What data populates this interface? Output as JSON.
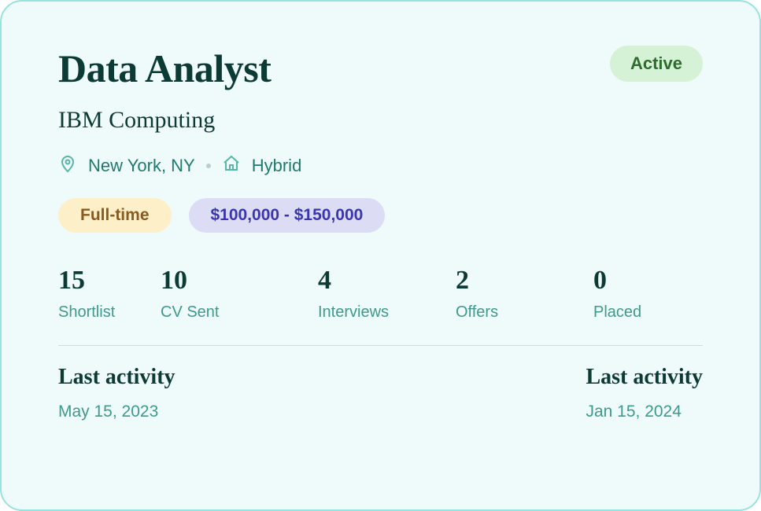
{
  "job": {
    "title": "Data Analyst",
    "company": "IBM Computing",
    "location": "New York, NY",
    "work_mode": "Hybrid",
    "status": "Active",
    "employment_type": "Full-time",
    "salary_range": "$100,000 - $150,000"
  },
  "stats": [
    {
      "value": "15",
      "label": "Shortlist"
    },
    {
      "value": "10",
      "label": "CV Sent"
    },
    {
      "value": "4",
      "label": "Interviews"
    },
    {
      "value": "2",
      "label": "Offers"
    },
    {
      "value": "0",
      "label": "Placed"
    }
  ],
  "activity": {
    "left": {
      "title": "Last activity",
      "date": "May 15, 2023"
    },
    "right": {
      "title": "Last activity",
      "date": "Jan 15, 2024"
    }
  }
}
